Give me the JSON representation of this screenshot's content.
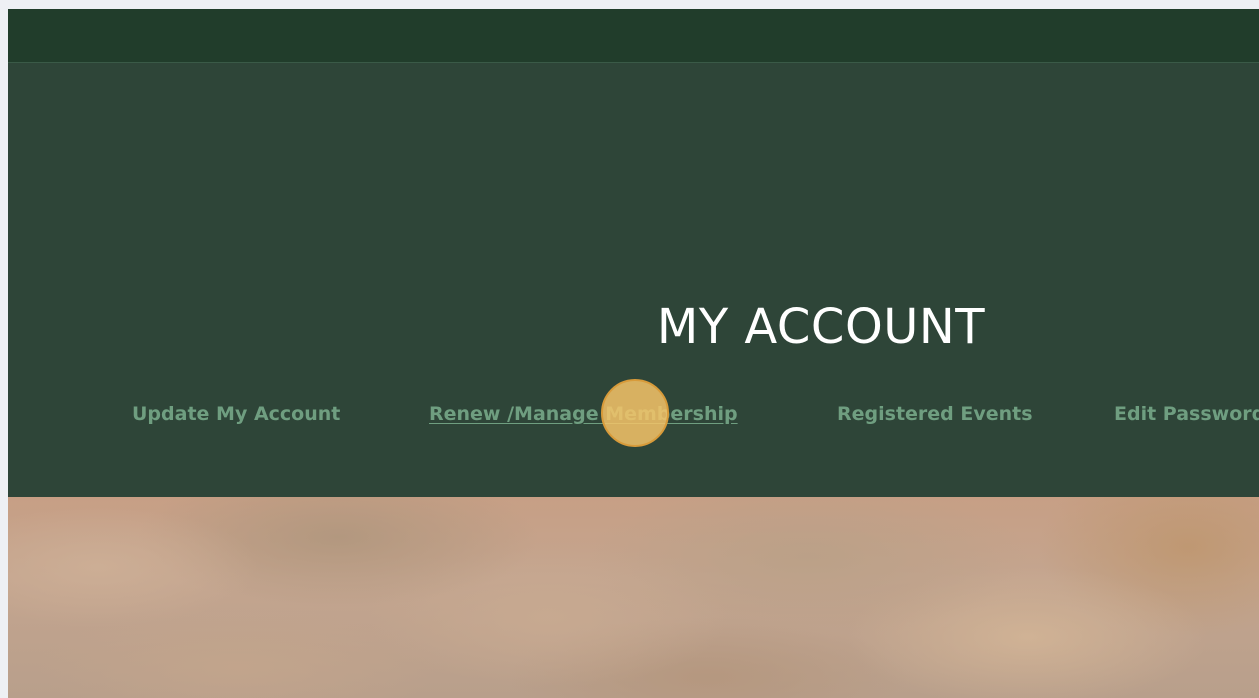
{
  "header": {
    "title": "MY ACCOUNT"
  },
  "nav": {
    "items": [
      {
        "label": "Update My Account"
      },
      {
        "label": "Renew /Manage Membership"
      },
      {
        "label": "Registered Events"
      },
      {
        "label": "Edit Password"
      }
    ],
    "active_index": 1
  },
  "colors": {
    "topbar": "#213d2b",
    "hero": "#2e4538",
    "nav_link": "#6f9e80",
    "title": "#ffffff",
    "click_marker": "#f6c468"
  }
}
